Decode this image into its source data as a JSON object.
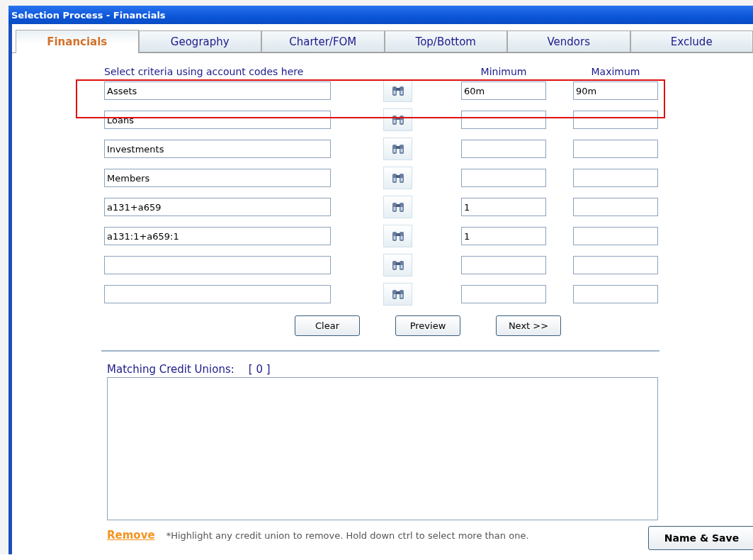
{
  "window": {
    "title": "Selection Process - Financials"
  },
  "tabs": [
    {
      "label": "Financials",
      "selected": true
    },
    {
      "label": "Geography",
      "selected": false
    },
    {
      "label": "Charter/FOM",
      "selected": false
    },
    {
      "label": "Top/Bottom",
      "selected": false
    },
    {
      "label": "Vendors",
      "selected": false
    },
    {
      "label": "Exclude",
      "selected": false
    }
  ],
  "criteria": {
    "heading": "Select criteria using account codes here",
    "minimum_heading": "Minimum",
    "maximum_heading": "Maximum",
    "rows": [
      {
        "code": "Assets",
        "minimum": "60m",
        "maximum": "90m"
      },
      {
        "code": "Loans",
        "minimum": "",
        "maximum": ""
      },
      {
        "code": "Investments",
        "minimum": "",
        "maximum": ""
      },
      {
        "code": "Members",
        "minimum": "",
        "maximum": ""
      },
      {
        "code": "a131+a659",
        "minimum": "1",
        "maximum": ""
      },
      {
        "code": "a131:1+a659:1",
        "minimum": "1",
        "maximum": ""
      },
      {
        "code": "",
        "minimum": "",
        "maximum": ""
      },
      {
        "code": "",
        "minimum": "",
        "maximum": ""
      }
    ]
  },
  "highlight_frame": true,
  "buttons": [
    "Clear",
    "Preview",
    "Next >>"
  ],
  "matching": {
    "label": "Matching Credit Unions:",
    "count": "[ 0 ]"
  },
  "remove_link": "Remove",
  "hint": "*Highlight any credit union to remove. Hold down ctrl to select more than one.",
  "save_button": "Name & Save"
}
